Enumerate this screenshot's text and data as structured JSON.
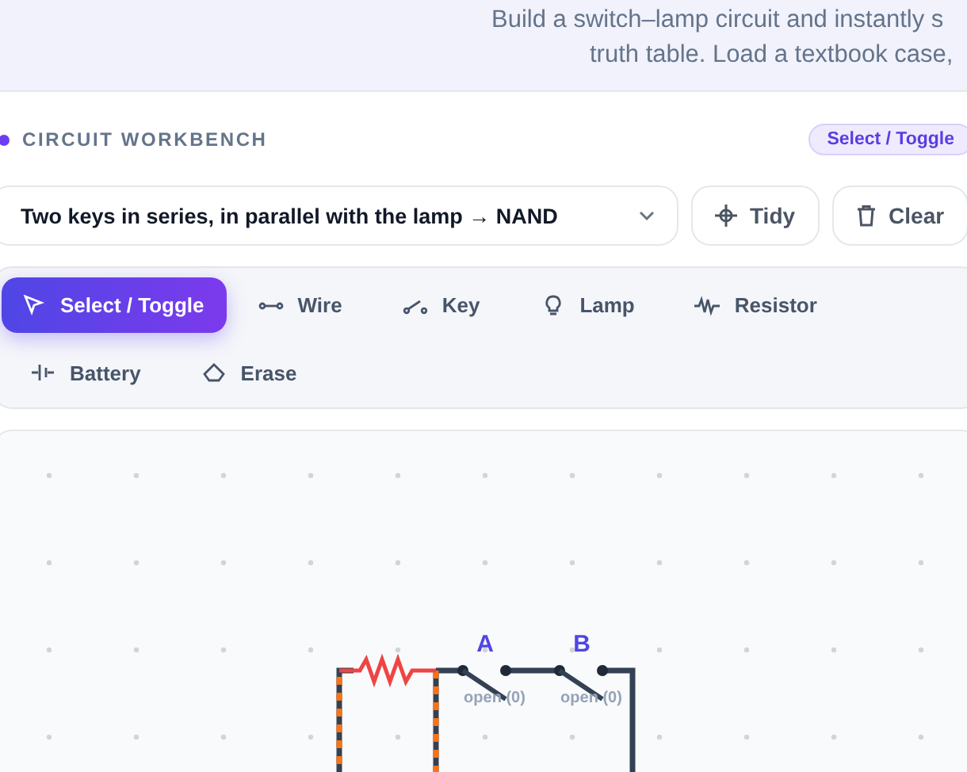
{
  "intro": {
    "lines": [
      "Build a switch–lamp circuit and instantly s",
      "truth table. Load a textbook case,"
    ]
  },
  "workbench": {
    "title": "CIRCUIT WORKBENCH",
    "mode_badge": "Select / Toggle",
    "preset": {
      "value": "Two keys in series, in parallel with the lamp → NAND"
    },
    "actions": [
      {
        "kind": "tidy",
        "label": "Tidy"
      },
      {
        "kind": "clear",
        "label": "Clear"
      }
    ],
    "tools": [
      {
        "kind": "select",
        "label": "Select / Toggle",
        "selected": true
      },
      {
        "kind": "wire",
        "label": "Wire",
        "selected": false
      },
      {
        "kind": "key",
        "label": "Key",
        "selected": false
      },
      {
        "kind": "lamp",
        "label": "Lamp",
        "selected": false
      },
      {
        "kind": "resistor",
        "label": "Resistor",
        "selected": false
      },
      {
        "kind": "battery",
        "label": "Battery",
        "selected": false
      },
      {
        "kind": "erase",
        "label": "Erase",
        "selected": false
      }
    ],
    "canvas": {
      "keys": [
        {
          "label": "A",
          "state_text": "open (0)",
          "closed": false
        },
        {
          "label": "B",
          "state_text": "open (0)",
          "closed": false
        }
      ]
    }
  }
}
